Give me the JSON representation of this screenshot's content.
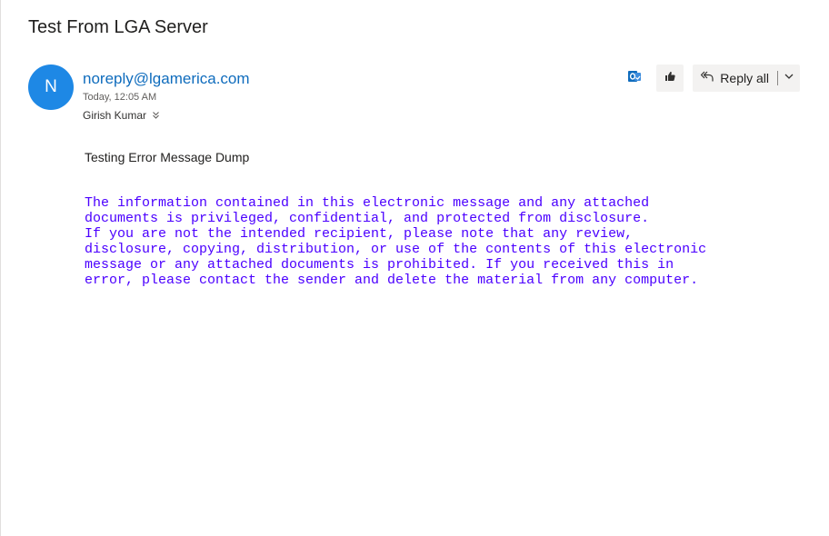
{
  "message": {
    "subject": "Test From LGA Server",
    "avatar_initial": "N",
    "sender": "noreply@lgamerica.com",
    "time": "Today, 12:05 AM",
    "recipients": "Girish Kumar",
    "body_line": "Testing Error Message Dump",
    "disclaimer": [
      "The information contained in this electronic message and any attached",
      "documents is privileged, confidential, and protected from disclosure.",
      "If you are not the intended recipient, please note that any review,",
      "disclosure, copying, distribution, or use of the contents of this electronic",
      "message or any attached documents is prohibited. If you received this in",
      "error, please contact the sender and delete the material from any computer."
    ]
  },
  "toolbar": {
    "reply_all_label": "Reply all"
  },
  "icons": {
    "outlook": "outlook-app-icon",
    "like": "thumbs-up-icon",
    "reply_all": "reply-all-icon",
    "more": "chevron-down-icon",
    "expand": "double-chevron-down-icon"
  },
  "colors": {
    "avatar_bg": "#1e88e5",
    "sender_link": "#0f6cbd",
    "disclaimer_text": "#4b00ff",
    "toolbar_bg": "#f3f2f1"
  }
}
